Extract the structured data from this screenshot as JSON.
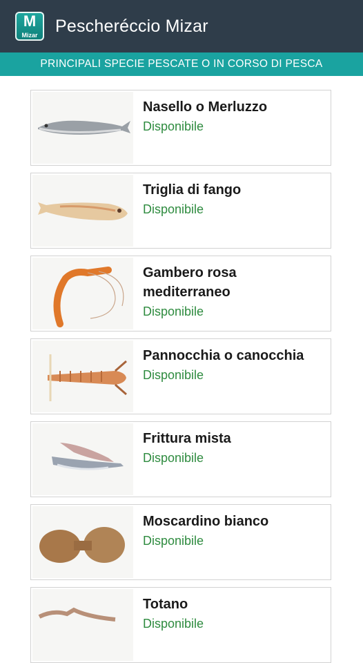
{
  "app": {
    "title": "Pescheréccio Mizar",
    "icon_letter": "M",
    "icon_word": "Mizar",
    "subheader": "PRINCIPALI SPECIE PESCATE O IN CORSO DI PESCA"
  },
  "colors": {
    "actionbar": "#2f3d4a",
    "subheader": "#1aa3a0",
    "status": "#2e8b3f"
  },
  "items": [
    {
      "name": "Nasello o Merluzzo",
      "status": "Disponibile",
      "icon": "hake-fish-image"
    },
    {
      "name": "Triglia di fango",
      "status": "Disponibile",
      "icon": "red-mullet-image"
    },
    {
      "name": "Gambero rosa mediterraneo",
      "status": "Disponibile",
      "icon": "pink-shrimp-image"
    },
    {
      "name": "Pannocchia o canocchia",
      "status": "Disponibile",
      "icon": "mantis-shrimp-image"
    },
    {
      "name": "Frittura mista",
      "status": "Disponibile",
      "icon": "mixed-fry-image"
    },
    {
      "name": "Moscardino bianco",
      "status": "Disponibile",
      "icon": "octopus-image"
    },
    {
      "name": "Totano",
      "status": "Disponibile",
      "icon": "squid-image"
    }
  ]
}
